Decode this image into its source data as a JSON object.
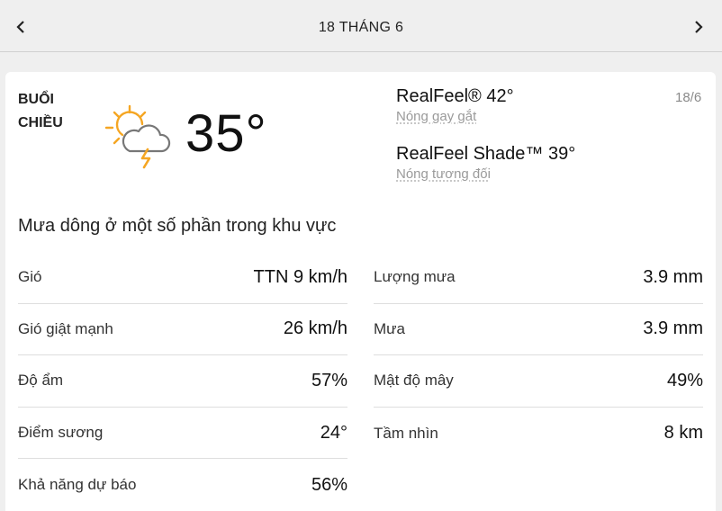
{
  "header": {
    "date_title": "18 THÁNG 6",
    "prev_icon": "chevron-left-icon",
    "next_icon": "chevron-right-icon"
  },
  "current": {
    "period": "BUỔI\nCHIỀU",
    "icon": "partly-sunny-thunderstorm-icon",
    "temperature": "35°",
    "realfeel_label": "RealFeel® 42°",
    "realfeel_desc": "Nóng gay gắt",
    "realfeel_shade_label": "RealFeel Shade™ 39°",
    "realfeel_shade_desc": "Nóng tương đối",
    "date_short": "18/6",
    "phrase": "Mưa dông ở một số phần trong khu vực"
  },
  "details_left": [
    {
      "label": "Gió",
      "value": "TTN 9 km/h"
    },
    {
      "label": "Gió giật mạnh",
      "value": "26 km/h"
    },
    {
      "label": "Độ ẩm",
      "value": "57%"
    },
    {
      "label": "Điểm sương",
      "value": "24°"
    },
    {
      "label": "Khả năng dự báo",
      "value": "56%"
    }
  ],
  "details_right": [
    {
      "label": "Lượng mưa",
      "value": "3.9 mm"
    },
    {
      "label": "Mưa",
      "value": "3.9 mm"
    },
    {
      "label": "Mật độ mây",
      "value": "49%"
    },
    {
      "label": "Tầm nhìn",
      "value": "8 km"
    }
  ],
  "colors": {
    "sun": "#f5a623",
    "bolt": "#f5a623",
    "cloud_stroke": "#777777",
    "background": "#efefef",
    "card": "#ffffff"
  }
}
